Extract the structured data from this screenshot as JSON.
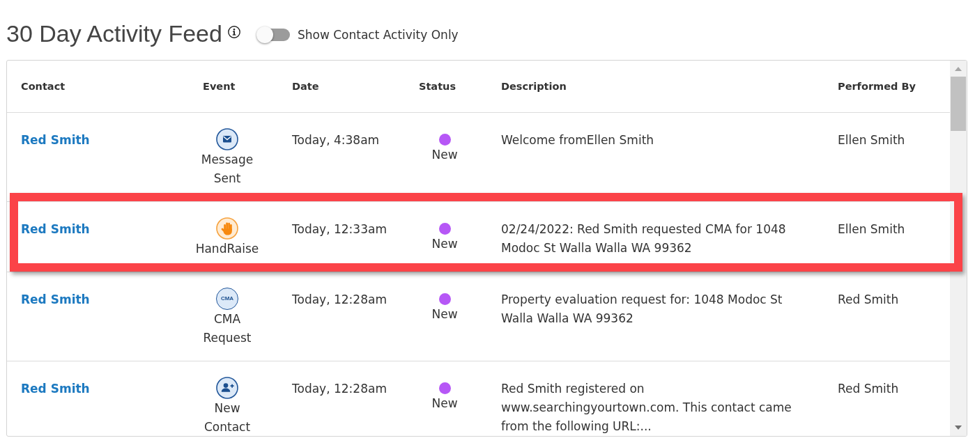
{
  "header": {
    "title": "30 Day Activity Feed",
    "filter_toggle": {
      "label": "Show Contact Activity Only",
      "on": false
    }
  },
  "table": {
    "columns": [
      "Contact",
      "Event",
      "Date",
      "Status",
      "Description",
      "Performed By"
    ],
    "rows": [
      {
        "contact": "Red Smith",
        "event": {
          "kind": "message",
          "label": "Message Sent"
        },
        "date": "Today, 4:38am",
        "status": {
          "label": "New",
          "color": "#b657f6"
        },
        "description": "Welcome fromEllen Smith",
        "performed_by": "Ellen Smith",
        "highlighted": false
      },
      {
        "contact": "Red Smith",
        "event": {
          "kind": "handraise",
          "label": "HandRaise"
        },
        "date": "Today, 12:33am",
        "status": {
          "label": "New",
          "color": "#b657f6"
        },
        "description": "02/24/2022: Red Smith requested CMA for 1048 Modoc St Walla Walla WA 99362",
        "performed_by": "Ellen Smith",
        "highlighted": true
      },
      {
        "contact": "Red Smith",
        "event": {
          "kind": "cma",
          "label": "CMA Request",
          "icon_text": "CMA"
        },
        "date": "Today, 12:28am",
        "status": {
          "label": "New",
          "color": "#b657f6"
        },
        "description": "Property evaluation request for: 1048 Modoc St Walla Walla WA 99362",
        "performed_by": "Red Smith",
        "highlighted": false
      },
      {
        "contact": "Red Smith",
        "event": {
          "kind": "new_contact",
          "label": "New Contact"
        },
        "date": "Today, 12:28am",
        "status": {
          "label": "New",
          "color": "#b657f6"
        },
        "description": "Red Smith registered on www.searchingyourtown.com. This contact came from the following URL:...",
        "performed_by": "Red Smith",
        "highlighted": false
      }
    ]
  }
}
